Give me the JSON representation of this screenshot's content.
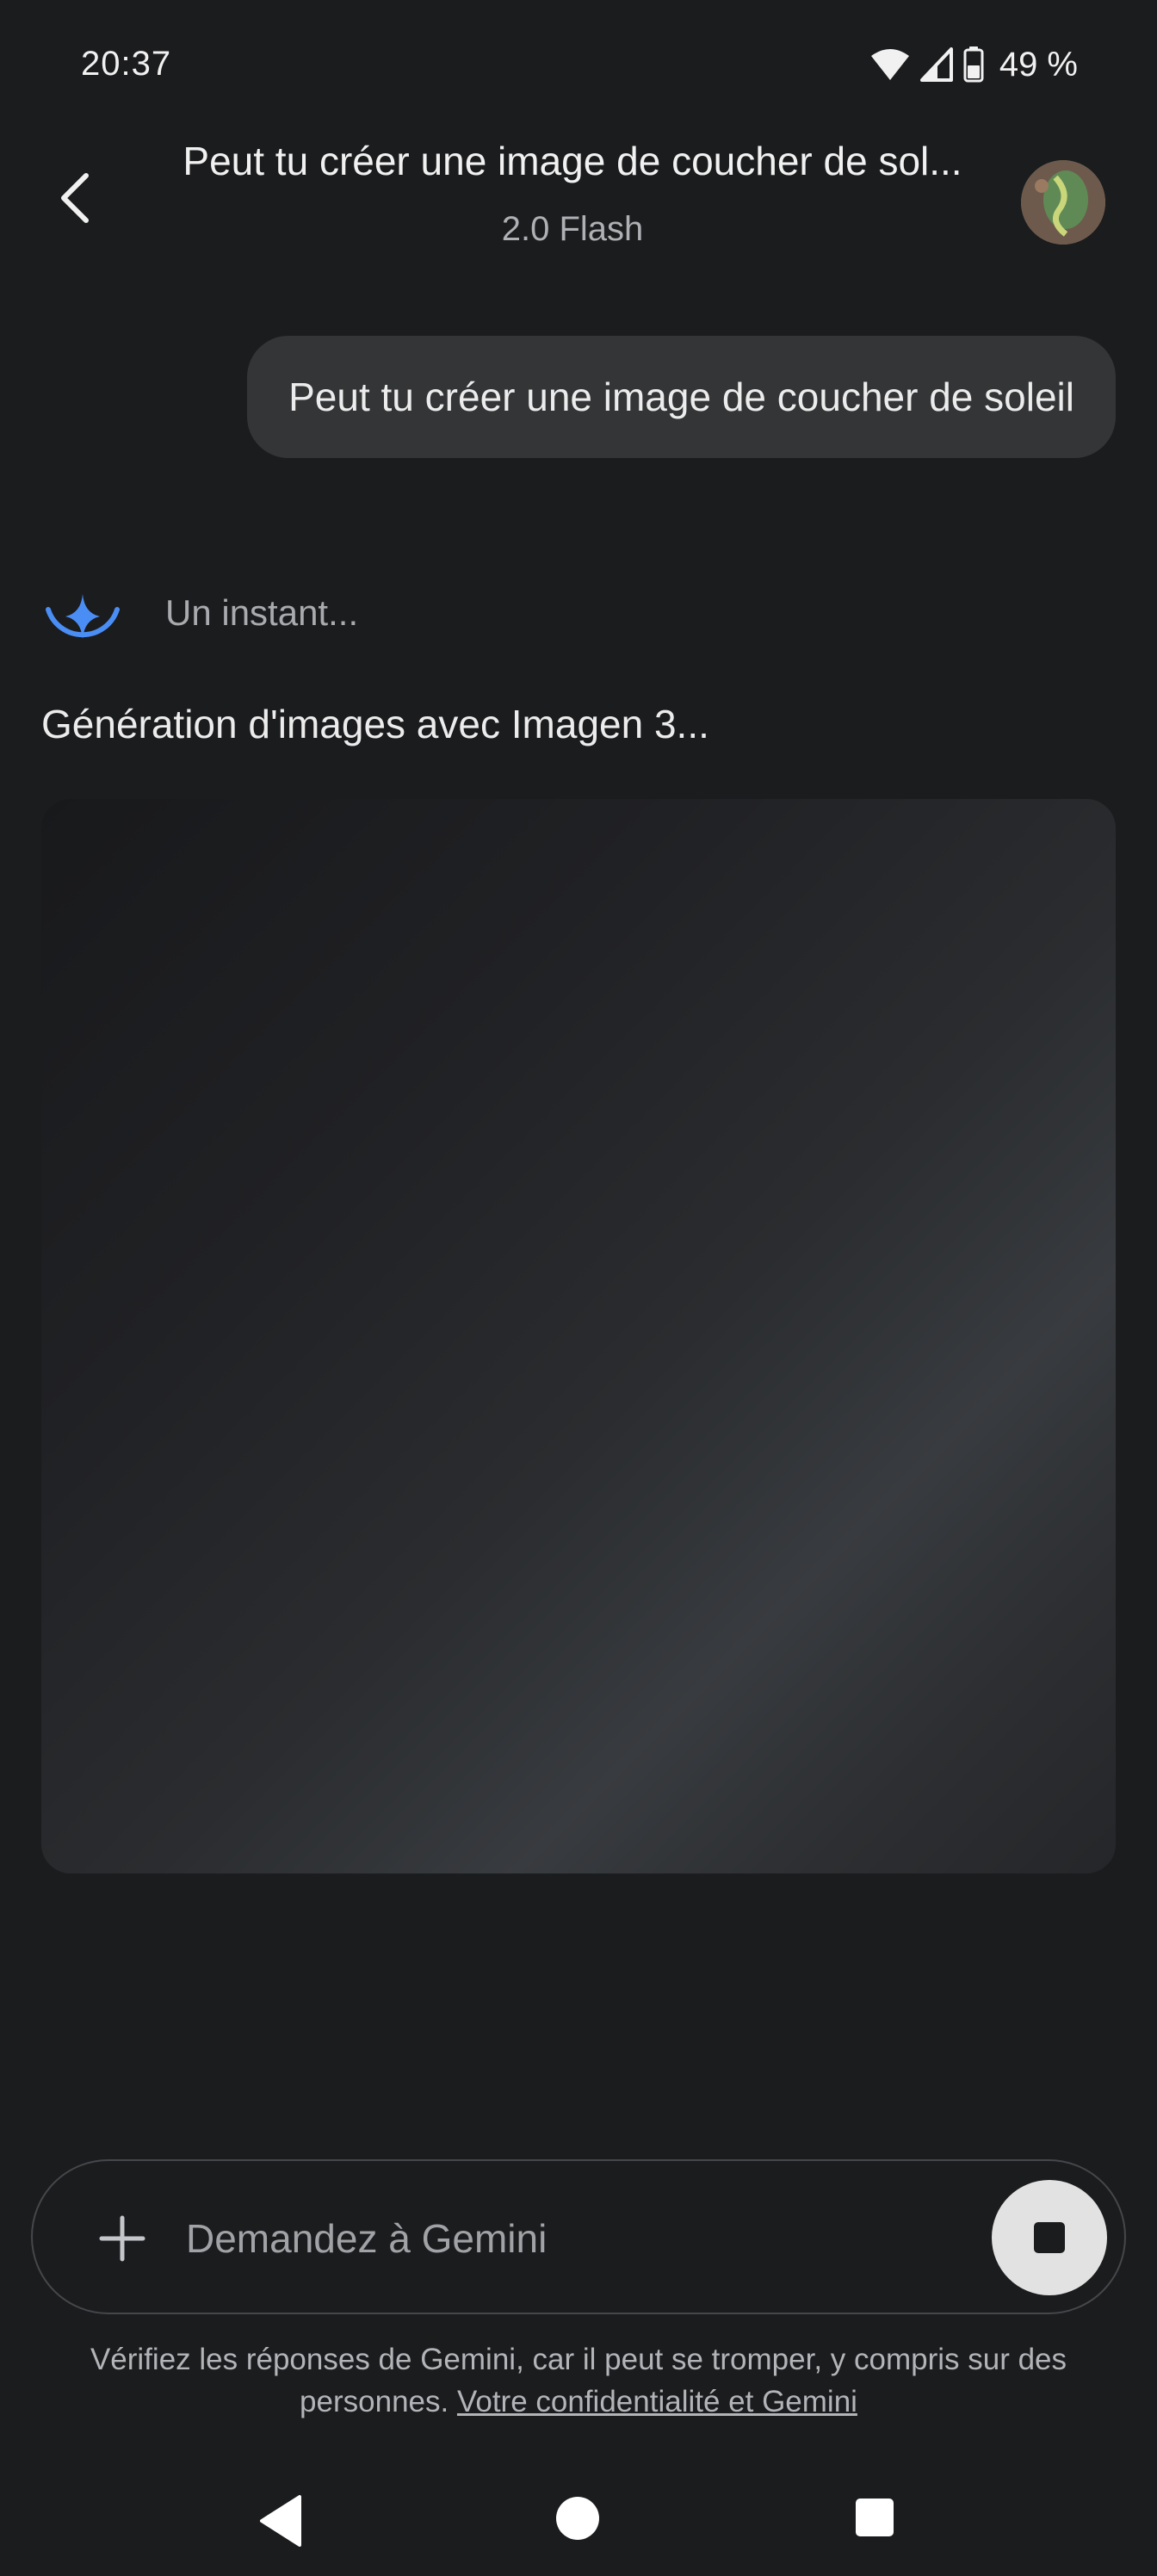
{
  "status_bar": {
    "time": "20:37",
    "battery": "49 %",
    "icons": [
      "wifi-icon",
      "signal-icon",
      "battery-icon"
    ]
  },
  "header": {
    "title": "Peut tu créer une image de coucher de sol...",
    "subtitle": "2.0 Flash",
    "back_icon": "chevron-left-icon",
    "avatar": "user-avatar"
  },
  "conversation": {
    "user_message": "Peut tu créer une image de coucher de soleil",
    "assistant": {
      "status": "Un instant...",
      "generation_text": "Génération d'images avec Imagen 3...",
      "icon": "gemini-sparkle-icon"
    }
  },
  "input": {
    "placeholder": "Demandez à Gemini",
    "plus_icon": "plus-icon",
    "stop_icon": "stop-icon"
  },
  "disclaimer": {
    "text": "Vérifiez les réponses de Gemini, car il peut se tromper, y compris sur des personnes.",
    "link": "Votre confidentialité et Gemini"
  },
  "nav_bar": {
    "icons": [
      "nav-back-icon",
      "nav-home-icon",
      "nav-recents-icon"
    ]
  },
  "colors": {
    "background": "#1b1c1e",
    "bubble": "#333537",
    "accent": "#4a8ef5",
    "stop_button": "#e2e2e2"
  }
}
